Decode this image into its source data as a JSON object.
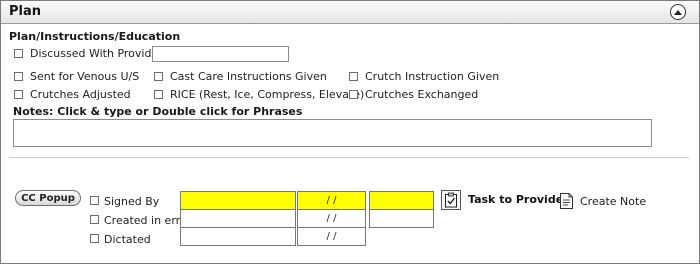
{
  "panel": {
    "title": "Plan",
    "collapse_icon": "chevron-up-icon"
  },
  "section": {
    "title": "Plan/Instructions/Education"
  },
  "options": {
    "discussed_with_provider": "Discussed With Provider:",
    "sent_for_venous": "Sent for Venous U/S",
    "cast_care": "Cast Care Instructions Given",
    "crutch_instruction": "Crutch Instruction Given",
    "crutches_adjusted": "Crutches Adjusted",
    "rice": "RICE (Rest, Ice, Compress, Elevate)",
    "crutches_exchanged": "Crutches Exchanged"
  },
  "notes": {
    "label": "Notes: Click & type or Double click for Phrases",
    "value": ""
  },
  "signature": {
    "cc_popup_label": "CC Popup",
    "signed_by": "Signed By",
    "created_in_error": "Created in error",
    "dictated": "Dictated",
    "date_placeholder": "/ /",
    "highlight_color": "#ffff00"
  },
  "actions": {
    "task_to_provider": "Task to Provider",
    "create_note": "Create Note"
  }
}
